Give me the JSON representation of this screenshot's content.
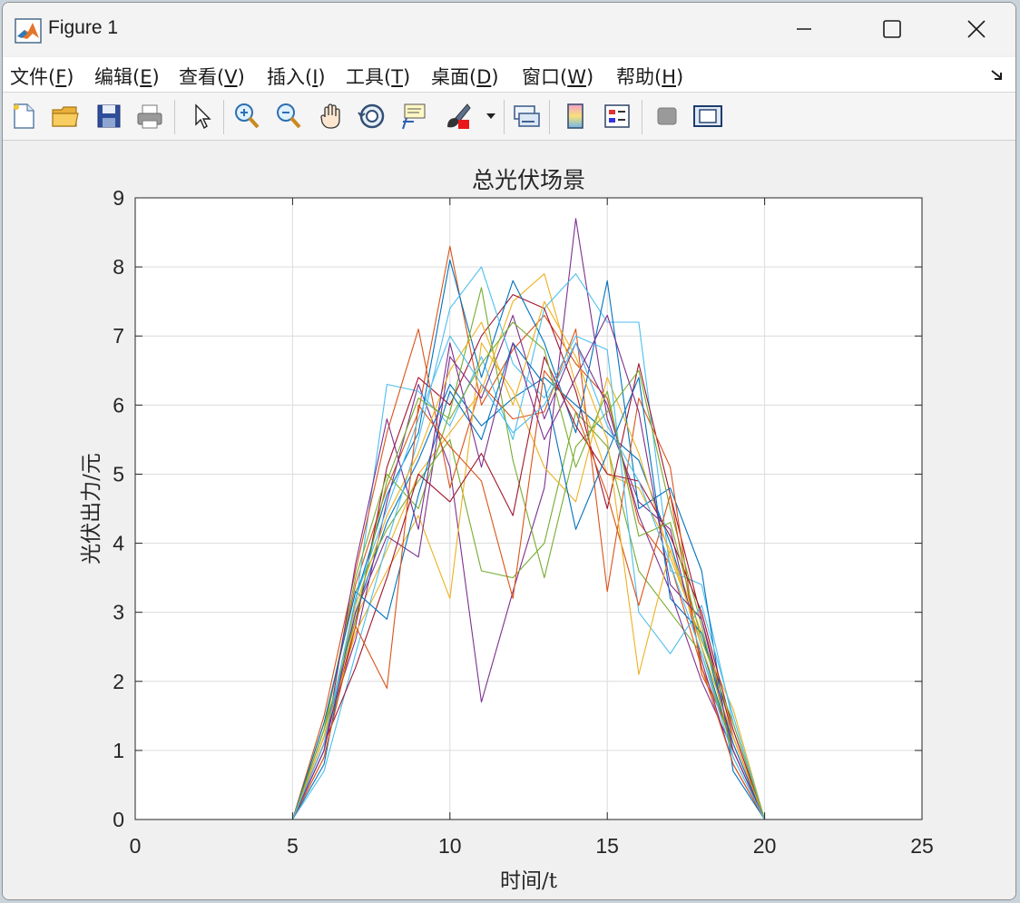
{
  "window": {
    "title": "Figure 1",
    "controls": {
      "minimize": "minimize",
      "maximize": "maximize",
      "close": "close"
    }
  },
  "menubar": {
    "items": [
      {
        "label": "文件(",
        "key": "F",
        "suffix": ")"
      },
      {
        "label": "编辑(",
        "key": "E",
        "suffix": ")"
      },
      {
        "label": "查看(",
        "key": "V",
        "suffix": ")"
      },
      {
        "label": "插入(",
        "key": "I",
        "suffix": ")"
      },
      {
        "label": "工具(",
        "key": "T",
        "suffix": ")"
      },
      {
        "label": "桌面(",
        "key": "D",
        "suffix": ")"
      },
      {
        "label": "窗口(",
        "key": "W",
        "suffix": ")"
      },
      {
        "label": "帮助(",
        "key": "H",
        "suffix": ")"
      }
    ]
  },
  "toolbar": {
    "icons": [
      "new-file-icon",
      "open-folder-icon",
      "save-icon",
      "print-icon",
      "pointer-icon",
      "zoom-in-icon",
      "zoom-out-icon",
      "pan-hand-icon",
      "rotate-3d-icon",
      "data-cursor-icon",
      "brush-icon",
      "brush-dropdown-icon",
      "link-plot-icon",
      "colorbar-icon",
      "legend-icon",
      "hide-plot-tools-icon",
      "show-plot-tools-icon"
    ]
  },
  "colors": {
    "series": [
      "#0072BD",
      "#D95319",
      "#EDB120",
      "#7E2F8E",
      "#77AC30",
      "#4DBEEE",
      "#A2142F"
    ],
    "grid": "#dcdcdc",
    "axes_bg": "#ffffff"
  },
  "chart_data": {
    "type": "line",
    "title": "总光伏场景",
    "xlabel": "时间/t",
    "ylabel": "光伏出力/元",
    "xlim": [
      0,
      25
    ],
    "ylim": [
      0,
      9
    ],
    "xticks": [
      0,
      5,
      10,
      15,
      20,
      25
    ],
    "yticks": [
      0,
      1,
      2,
      3,
      4,
      5,
      6,
      7,
      8,
      9
    ],
    "grid": true,
    "x": [
      1,
      2,
      3,
      4,
      5,
      6,
      7,
      8,
      9,
      10,
      11,
      12,
      13,
      14,
      15,
      16,
      17,
      18,
      19,
      20,
      21,
      22,
      23,
      24
    ],
    "series": [
      {
        "values": [
          0,
          0,
          0,
          0,
          0,
          1.1,
          3.0,
          4.3,
          5.2,
          6.3,
          5.7,
          6.1,
          6.4,
          6.0,
          5.6,
          5.2,
          4.0,
          2.5,
          1.0,
          0,
          0,
          0,
          0,
          0
        ]
      },
      {
        "values": [
          0,
          0,
          0,
          0,
          0,
          1.3,
          3.4,
          4.8,
          5.9,
          8.3,
          6.0,
          6.8,
          7.3,
          6.6,
          6.1,
          4.3,
          3.7,
          2.2,
          1.1,
          0,
          0,
          0,
          0,
          0
        ]
      },
      {
        "values": [
          0,
          0,
          0,
          0,
          0,
          0.9,
          2.9,
          3.9,
          5.0,
          5.6,
          6.2,
          7.5,
          7.9,
          6.3,
          5.0,
          4.8,
          3.9,
          2.7,
          1.3,
          0,
          0,
          0,
          0,
          0
        ]
      },
      {
        "values": [
          0,
          0,
          0,
          0,
          0,
          1.2,
          2.6,
          4.6,
          6.3,
          5.1,
          1.7,
          3.3,
          4.8,
          8.7,
          5.8,
          4.6,
          4.2,
          2.3,
          0.8,
          0,
          0,
          0,
          0,
          0
        ]
      },
      {
        "values": [
          0,
          0,
          0,
          0,
          0,
          1.4,
          3.3,
          4.2,
          4.9,
          5.5,
          3.6,
          3.5,
          4.0,
          5.9,
          5.4,
          3.6,
          3.0,
          2.4,
          1.0,
          0,
          0,
          0,
          0,
          0
        ]
      },
      {
        "values": [
          0,
          0,
          0,
          0,
          0,
          1.0,
          3.1,
          6.3,
          6.2,
          5.7,
          6.7,
          5.5,
          7.4,
          7.9,
          7.2,
          7.2,
          3.6,
          3.4,
          1.4,
          0,
          0,
          0,
          0,
          0
        ]
      },
      {
        "values": [
          0,
          0,
          0,
          0,
          0,
          1.1,
          2.8,
          5.1,
          6.4,
          6.0,
          7.0,
          7.6,
          7.4,
          6.2,
          4.5,
          6.6,
          4.7,
          2.9,
          1.2,
          0,
          0,
          0,
          0,
          0
        ]
      },
      {
        "values": [
          0,
          0,
          0,
          0,
          0,
          0.8,
          3.2,
          4.7,
          5.6,
          8.1,
          6.4,
          7.8,
          6.9,
          5.6,
          7.8,
          4.5,
          4.8,
          3.6,
          0.7,
          0,
          0,
          0,
          0,
          0
        ]
      },
      {
        "values": [
          0,
          0,
          0,
          0,
          0,
          1.5,
          3.6,
          5.6,
          7.1,
          4.8,
          6.3,
          5.8,
          5.9,
          7.1,
          3.3,
          6.1,
          5.1,
          2.1,
          1.2,
          0,
          0,
          0,
          0,
          0
        ]
      },
      {
        "values": [
          0,
          0,
          0,
          0,
          0,
          1.2,
          2.7,
          3.6,
          4.4,
          3.2,
          6.9,
          6.2,
          5.1,
          4.6,
          6.4,
          5.3,
          3.8,
          2.6,
          1.6,
          0,
          0,
          0,
          0,
          0
        ]
      },
      {
        "values": [
          0,
          0,
          0,
          0,
          0,
          1.0,
          3.0,
          4.1,
          3.8,
          6.7,
          6.1,
          7.3,
          5.8,
          6.9,
          6.0,
          4.4,
          3.3,
          2.0,
          1.0,
          0,
          0,
          0,
          0,
          0
        ]
      },
      {
        "values": [
          0,
          0,
          0,
          0,
          0,
          1.3,
          3.5,
          5.0,
          4.5,
          5.9,
          7.7,
          5.2,
          3.5,
          5.4,
          5.9,
          6.5,
          4.5,
          2.8,
          0.9,
          0,
          0,
          0,
          0,
          0
        ]
      },
      {
        "values": [
          0,
          0,
          0,
          0,
          0,
          0.7,
          2.4,
          4.0,
          5.5,
          7.4,
          8.0,
          6.6,
          6.1,
          7.0,
          6.8,
          3.0,
          2.4,
          3.1,
          1.5,
          0,
          0,
          0,
          0,
          0
        ]
      },
      {
        "values": [
          0,
          0,
          0,
          0,
          0,
          1.1,
          2.2,
          3.5,
          5.0,
          4.6,
          5.3,
          4.4,
          6.7,
          5.7,
          5.0,
          4.9,
          4.1,
          3.0,
          1.3,
          0,
          0,
          0,
          0,
          0
        ]
      },
      {
        "values": [
          0,
          0,
          0,
          0,
          0,
          1.4,
          3.3,
          2.9,
          4.7,
          6.2,
          5.5,
          6.9,
          6.3,
          4.2,
          5.3,
          6.4,
          3.2,
          2.7,
          1.1,
          0,
          0,
          0,
          0,
          0
        ]
      },
      {
        "values": [
          0,
          0,
          0,
          0,
          0,
          0.9,
          2.8,
          1.9,
          6.0,
          5.4,
          4.9,
          3.2,
          6.5,
          5.9,
          4.7,
          3.1,
          4.7,
          2.2,
          0.8,
          0,
          0,
          0,
          0,
          0
        ]
      },
      {
        "values": [
          0,
          0,
          0,
          0,
          0,
          1.2,
          3.1,
          4.4,
          5.3,
          6.5,
          7.2,
          6.0,
          7.5,
          6.7,
          5.5,
          2.1,
          3.9,
          2.5,
          1.2,
          0,
          0,
          0,
          0,
          0
        ]
      },
      {
        "values": [
          0,
          0,
          0,
          0,
          0,
          1.0,
          3.7,
          5.8,
          4.2,
          6.9,
          5.1,
          6.9,
          5.5,
          6.4,
          7.3,
          5.9,
          3.4,
          2.9,
          1.0,
          0,
          0,
          0,
          0,
          0
        ]
      },
      {
        "values": [
          0,
          0,
          0,
          0,
          0,
          1.3,
          2.9,
          4.9,
          6.1,
          5.8,
          6.6,
          7.2,
          6.8,
          5.1,
          6.2,
          4.1,
          4.3,
          2.6,
          1.4,
          0,
          0,
          0,
          0,
          0
        ]
      },
      {
        "values": [
          0,
          0,
          0,
          0,
          0,
          1.1,
          3.2,
          4.5,
          5.8,
          7.0,
          6.3,
          5.6,
          6.0,
          6.9,
          5.7,
          4.9,
          3.7,
          2.4,
          0.9,
          0,
          0,
          0,
          0,
          0
        ]
      }
    ]
  }
}
